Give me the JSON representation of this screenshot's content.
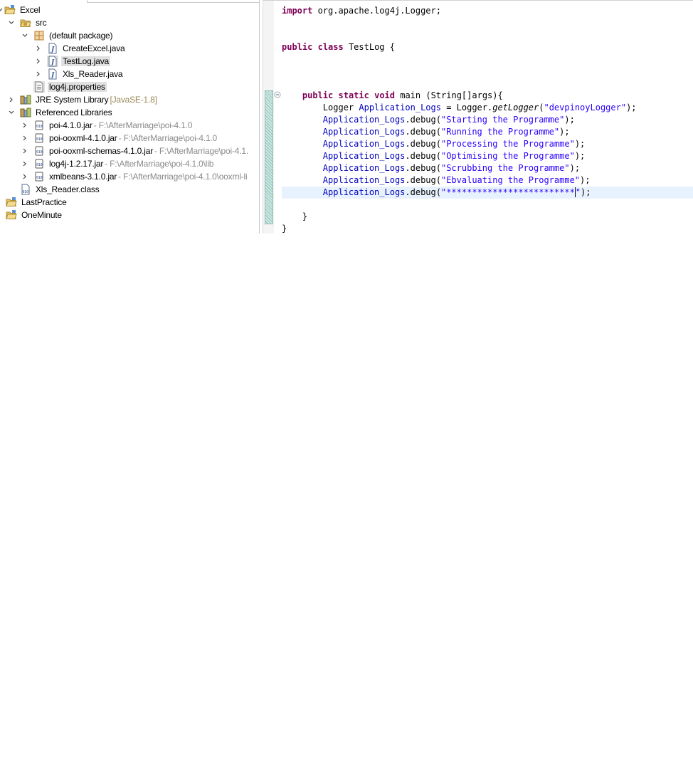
{
  "explorer": {
    "items": [
      {
        "label": "Excel",
        "decoration": ""
      },
      {
        "label": "src",
        "decoration": ""
      },
      {
        "label": "(default package)",
        "decoration": ""
      },
      {
        "label": "CreateExcel.java",
        "decoration": ""
      },
      {
        "label": "TestLog.java",
        "decoration": ""
      },
      {
        "label": "Xls_Reader.java",
        "decoration": ""
      },
      {
        "label": "log4j.properties",
        "decoration": ""
      },
      {
        "label": "JRE System Library",
        "decoration": "[JavaSE-1.8]"
      },
      {
        "label": "Referenced Libraries",
        "decoration": ""
      },
      {
        "label": "poi-4.1.0.jar",
        "decoration": "- F:\\AfterMarriage\\poi-4.1.0"
      },
      {
        "label": "poi-ooxml-4.1.0.jar",
        "decoration": "- F:\\AfterMarriage\\poi-4.1.0"
      },
      {
        "label": "poi-ooxml-schemas-4.1.0.jar",
        "decoration": "- F:\\AfterMarriage\\poi-4.1."
      },
      {
        "label": "log4j-1.2.17.jar",
        "decoration": "- F:\\AfterMarriage\\poi-4.1.0\\lib"
      },
      {
        "label": "xmlbeans-3.1.0.jar",
        "decoration": "- F:\\AfterMarriage\\poi-4.1.0\\ooxml-li"
      },
      {
        "label": "Xls_Reader.class",
        "decoration": ""
      },
      {
        "label": "LastPractice",
        "decoration": ""
      },
      {
        "label": "OneMinute",
        "decoration": ""
      }
    ]
  },
  "editor": {
    "lines": [
      {
        "kw1": "import",
        "rest": " org.apache.log4j.Logger;"
      },
      {
        "kw1": "public",
        "kw2": "class",
        "rest": " TestLog {"
      },
      {
        "kw1": "public",
        "kw2": "static",
        "kw3": "void",
        "rest": " main (String[]args){"
      },
      {
        "t1": "Logger ",
        "fld": "Application_Logs",
        "t2": " = Logger.",
        "m": "getLogger",
        "t3": "(",
        "str": "\"devpinoyLogger\"",
        "t4": ");"
      },
      {
        "fld": "Application_Logs",
        "t2": ".debug(",
        "str": "\"Starting the Programme\"",
        "t4": ");"
      },
      {
        "fld": "Application_Logs",
        "t2": ".debug(",
        "str": "\"Running the Programme\"",
        "t4": ");"
      },
      {
        "fld": "Application_Logs",
        "t2": ".debug(",
        "str": "\"Processing the Programme\"",
        "t4": ");"
      },
      {
        "fld": "Application_Logs",
        "t2": ".debug(",
        "str": "\"Optimising the Programme\"",
        "t4": ");"
      },
      {
        "fld": "Application_Logs",
        "t2": ".debug(",
        "str": "\"Scrubbing the Programme\"",
        "t4": ");"
      },
      {
        "fld": "Application_Logs",
        "t2": ".debug(",
        "str": "\"Ebvaluating the Programme\"",
        "t4": ");"
      },
      {
        "fld": "Application_Logs",
        "t2": ".debug(",
        "str": "\"*************************",
        "strEnd": "\"",
        "t4": ");"
      },
      {
        "rest": "}"
      },
      {
        "rest": "}"
      }
    ]
  }
}
